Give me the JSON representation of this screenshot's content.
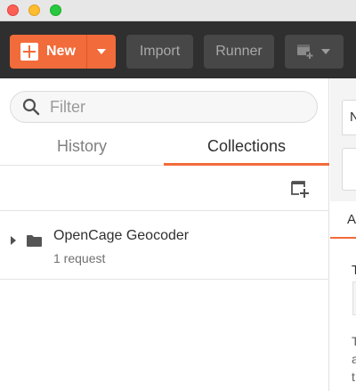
{
  "window": {
    "controls": [
      "close",
      "minimize",
      "zoom"
    ]
  },
  "toolbar": {
    "new_label": "New",
    "import_label": "Import",
    "runner_label": "Runner",
    "new_window_icon": "new-window-icon",
    "accent_color": "#f26b3a"
  },
  "sidebar": {
    "search": {
      "placeholder": "Filter",
      "value": ""
    },
    "tabs": [
      {
        "label": "History",
        "active": false
      },
      {
        "label": "Collections",
        "active": true
      }
    ],
    "new_collection_icon": "new-collection-icon",
    "collections": [
      {
        "name": "OpenCage Geocoder",
        "meta": "1 request",
        "icon": "folder-icon"
      }
    ]
  },
  "right_panel": {
    "tab_fragment": "N",
    "section_fragment": "A",
    "heading_fragment": "T",
    "text_fragment": [
      "T",
      "a",
      "t"
    ]
  }
}
